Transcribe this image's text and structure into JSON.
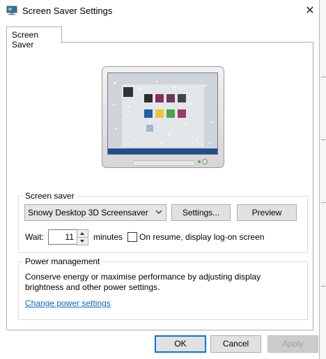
{
  "window": {
    "title": "Screen Saver Settings",
    "close_glyph": "✕"
  },
  "tabs": [
    {
      "label": "Screen Saver",
      "active": true
    }
  ],
  "screen_saver": {
    "group_label": "Screen saver",
    "selected": "Snowy Desktop 3D Screensaver",
    "settings_label": "Settings...",
    "preview_label": "Preview",
    "wait_label": "Wait:",
    "wait_value": "11",
    "minutes_label": "minutes",
    "resume_label": "On resume, display log-on screen",
    "resume_checked": false
  },
  "power_management": {
    "group_label": "Power management",
    "description": "Conserve energy or maximise performance by adjusting display brightness and other power settings.",
    "link_label": "Change power settings"
  },
  "buttons": {
    "ok": "OK",
    "cancel": "Cancel",
    "apply": "Apply"
  },
  "colors": {
    "accent": "#0078d7",
    "link": "#0a66c2",
    "disabled_text": "#9d9d9d"
  },
  "icons": [
    "screen-saver-app-icon",
    "close-icon",
    "chevron-down-icon",
    "spin-up-icon",
    "spin-down-icon"
  ]
}
